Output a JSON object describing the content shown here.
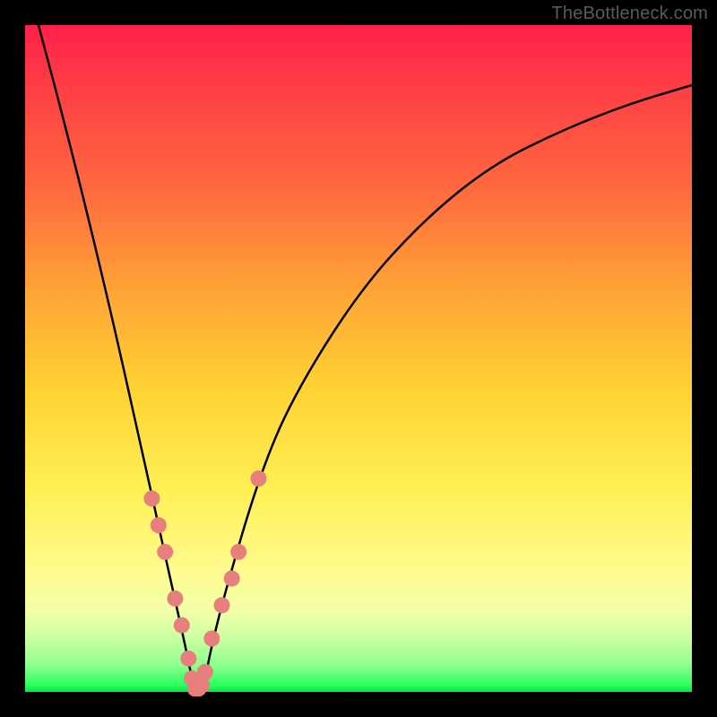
{
  "watermark": "TheBottleneck.com",
  "colors": {
    "frame": "#000000",
    "curve": "#000000",
    "marker_fill": "#e77f7f",
    "marker_stroke": "#d46b6b"
  },
  "chart_data": {
    "type": "line",
    "title": "",
    "xlabel": "",
    "ylabel": "",
    "xlim": [
      0,
      100
    ],
    "ylim": [
      0,
      100
    ],
    "grid": false,
    "note": "No numeric axes or tick labels are visible — values are normalized 0–100 positions estimated from the image.",
    "series": [
      {
        "name": "curve",
        "x": [
          2,
          6,
          10,
          14,
          18,
          20,
          22,
          24,
          25,
          26,
          27,
          28,
          30,
          35,
          40,
          50,
          60,
          70,
          80,
          90,
          100
        ],
        "y": [
          100,
          85,
          69,
          52,
          34,
          25,
          16,
          7,
          2,
          0,
          2,
          7,
          15,
          32,
          44,
          60,
          71,
          79,
          84,
          88,
          91
        ]
      }
    ],
    "markers": {
      "name": "highlighted-points",
      "x": [
        19,
        20,
        21,
        22.5,
        23.5,
        24.5,
        25,
        25.5,
        26,
        26.5,
        27,
        28,
        29.5,
        31,
        32,
        35
      ],
      "y": [
        29,
        25,
        21,
        14,
        10,
        5,
        2,
        0.5,
        0.5,
        1,
        3,
        8,
        13,
        17,
        21,
        32
      ]
    },
    "gradient_stops": [
      {
        "pos": 0.0,
        "color": "#ff1f4a"
      },
      {
        "pos": 0.25,
        "color": "#ff6a3e"
      },
      {
        "pos": 0.55,
        "color": "#ffd334"
      },
      {
        "pos": 0.82,
        "color": "#fffb8f"
      },
      {
        "pos": 0.96,
        "color": "#8fff8f"
      },
      {
        "pos": 1.0,
        "color": "#00e64a"
      }
    ]
  }
}
